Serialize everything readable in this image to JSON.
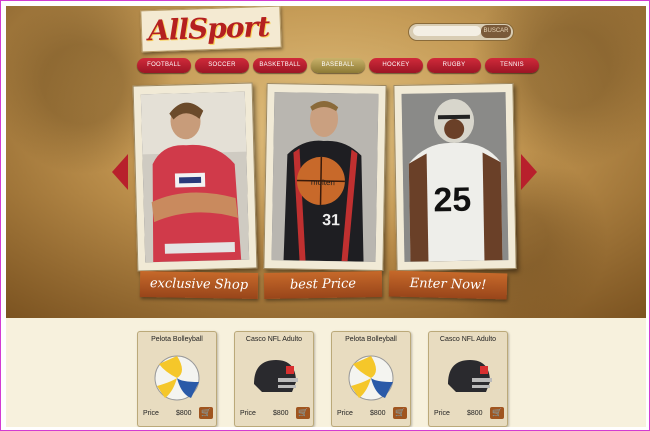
{
  "logo": {
    "text": "AllSport"
  },
  "search": {
    "placeholder": "",
    "button": "BUSCAR"
  },
  "nav": [
    "FOOTBALL",
    "SOCCER",
    "BASKETBALL",
    "BASEBALL",
    "HOCKEY",
    "RUGBY",
    "TENNIS"
  ],
  "nav_active": "BASEBALL",
  "banners": [
    "exclusive Shop",
    "best Price",
    "Enter Now!"
  ],
  "photo_labels": {
    "jersey_number": "25",
    "ball_text": "molten",
    "shorts_number": "31"
  },
  "products": [
    {
      "title": "Pelota Bolleyball",
      "price_label": "Price",
      "price": "$800",
      "icon": "volleyball-icon"
    },
    {
      "title": "Casco NFL Adulto",
      "price_label": "Price",
      "price": "$800",
      "icon": "helmet-icon"
    },
    {
      "title": "Pelota Bolleyball",
      "price_label": "Price",
      "price": "$800",
      "icon": "volleyball-icon"
    },
    {
      "title": "Casco NFL Adulto",
      "price_label": "Price",
      "price": "$800",
      "icon": "helmet-icon"
    }
  ],
  "colors": {
    "frame": "#d23cd2",
    "nav_red": "#b8202c",
    "nav_active": "#9d8a40",
    "ribbon": "#b05a22"
  }
}
